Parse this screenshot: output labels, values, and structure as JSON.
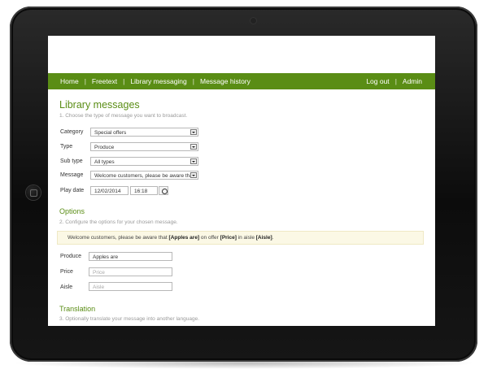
{
  "nav": {
    "items": [
      "Home",
      "Freetext",
      "Library messaging",
      "Message history"
    ],
    "right": [
      "Log out",
      "Admin"
    ]
  },
  "page": {
    "title": "Library messages",
    "hint": "1. Choose the type of message you want to broadcast."
  },
  "form": {
    "category_label": "Category",
    "category_value": "Special offers",
    "type_label": "Type",
    "type_value": "Produce",
    "subtype_label": "Sub type",
    "subtype_value": "All types",
    "message_label": "Message",
    "message_value": "Welcome customers, please be aware that",
    "playdate_label": "Play date",
    "date_value": "12/02/2014",
    "time_value": "16:18"
  },
  "options": {
    "title": "Options",
    "hint": "2. Configure the options for your chosen message.",
    "preview": {
      "part1": "Welcome customers, please be aware that ",
      "bold1": "[Apples are]",
      "part2": " on offer ",
      "bold2": "[Price]",
      "part3": " in aisle ",
      "bold3": "[Aisle]",
      "part4": "."
    },
    "produce_label": "Produce",
    "produce_value": "Apples are",
    "price_label": "Price",
    "price_placeholder": "Price",
    "aisle_label": "Aisle",
    "aisle_placeholder": "Aisle"
  },
  "translation": {
    "title": "Translation",
    "hint": "3. Optionally translate your message into another language."
  },
  "colors": {
    "accent": "#5a8d15",
    "preview_bg": "#fbf8e5"
  }
}
